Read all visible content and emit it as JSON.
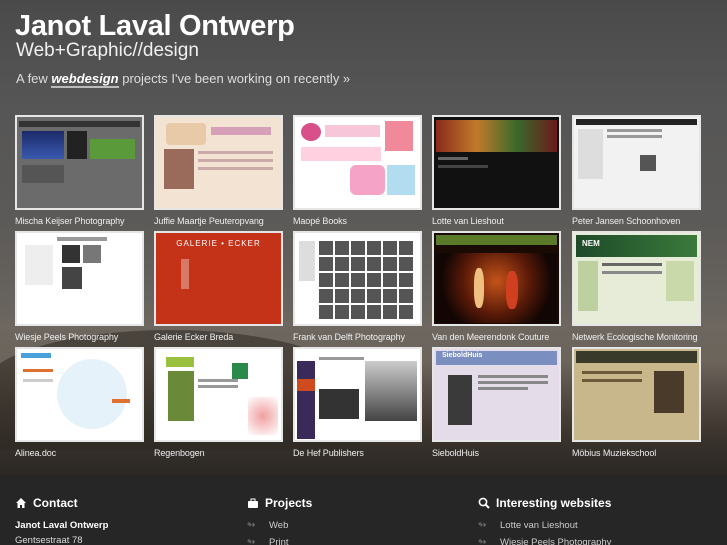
{
  "header": {
    "title": "Janot Laval Ontwerp",
    "subtitle": "Web+Graphic//design",
    "intro_prefix": "A few ",
    "intro_link": "webdesign",
    "intro_suffix": " projects I've been working on recently »"
  },
  "projects": [
    {
      "label": "Mischa Keijser Photography"
    },
    {
      "label": "Juffie Maartje Peuteropvang"
    },
    {
      "label": "Maopé Books"
    },
    {
      "label": "Lotte van Lieshout"
    },
    {
      "label": "Peter Jansen Schoonhoven"
    },
    {
      "label": "Wiesje Peels Photography"
    },
    {
      "label": "Galerie Ecker Breda"
    },
    {
      "label": "Frank van Delft Photography"
    },
    {
      "label": "Van den Meerendonk Couture"
    },
    {
      "label": "Netwerk Ecologische Monitoring"
    },
    {
      "label": "Alinea.doc"
    },
    {
      "label": "Regenbogen"
    },
    {
      "label": "De Hef Publishers"
    },
    {
      "label": "SieboldHuis"
    },
    {
      "label": "Möbius Muziekschool"
    }
  ],
  "thumb_text": {
    "galerie": "GALERIE • ECKER",
    "nem": "NEM",
    "siebold": "SieboldHuis"
  },
  "footer": {
    "contact": {
      "title": "Contact",
      "name": "Janot Laval Ontwerp",
      "address": "Gentsestraat 78"
    },
    "projects": {
      "title": "Projects",
      "items": [
        "Web",
        "Print"
      ]
    },
    "websites": {
      "title": "Interesting websites",
      "items": [
        "Lotte van Lieshout",
        "Wiesje Peels Photography"
      ]
    }
  }
}
